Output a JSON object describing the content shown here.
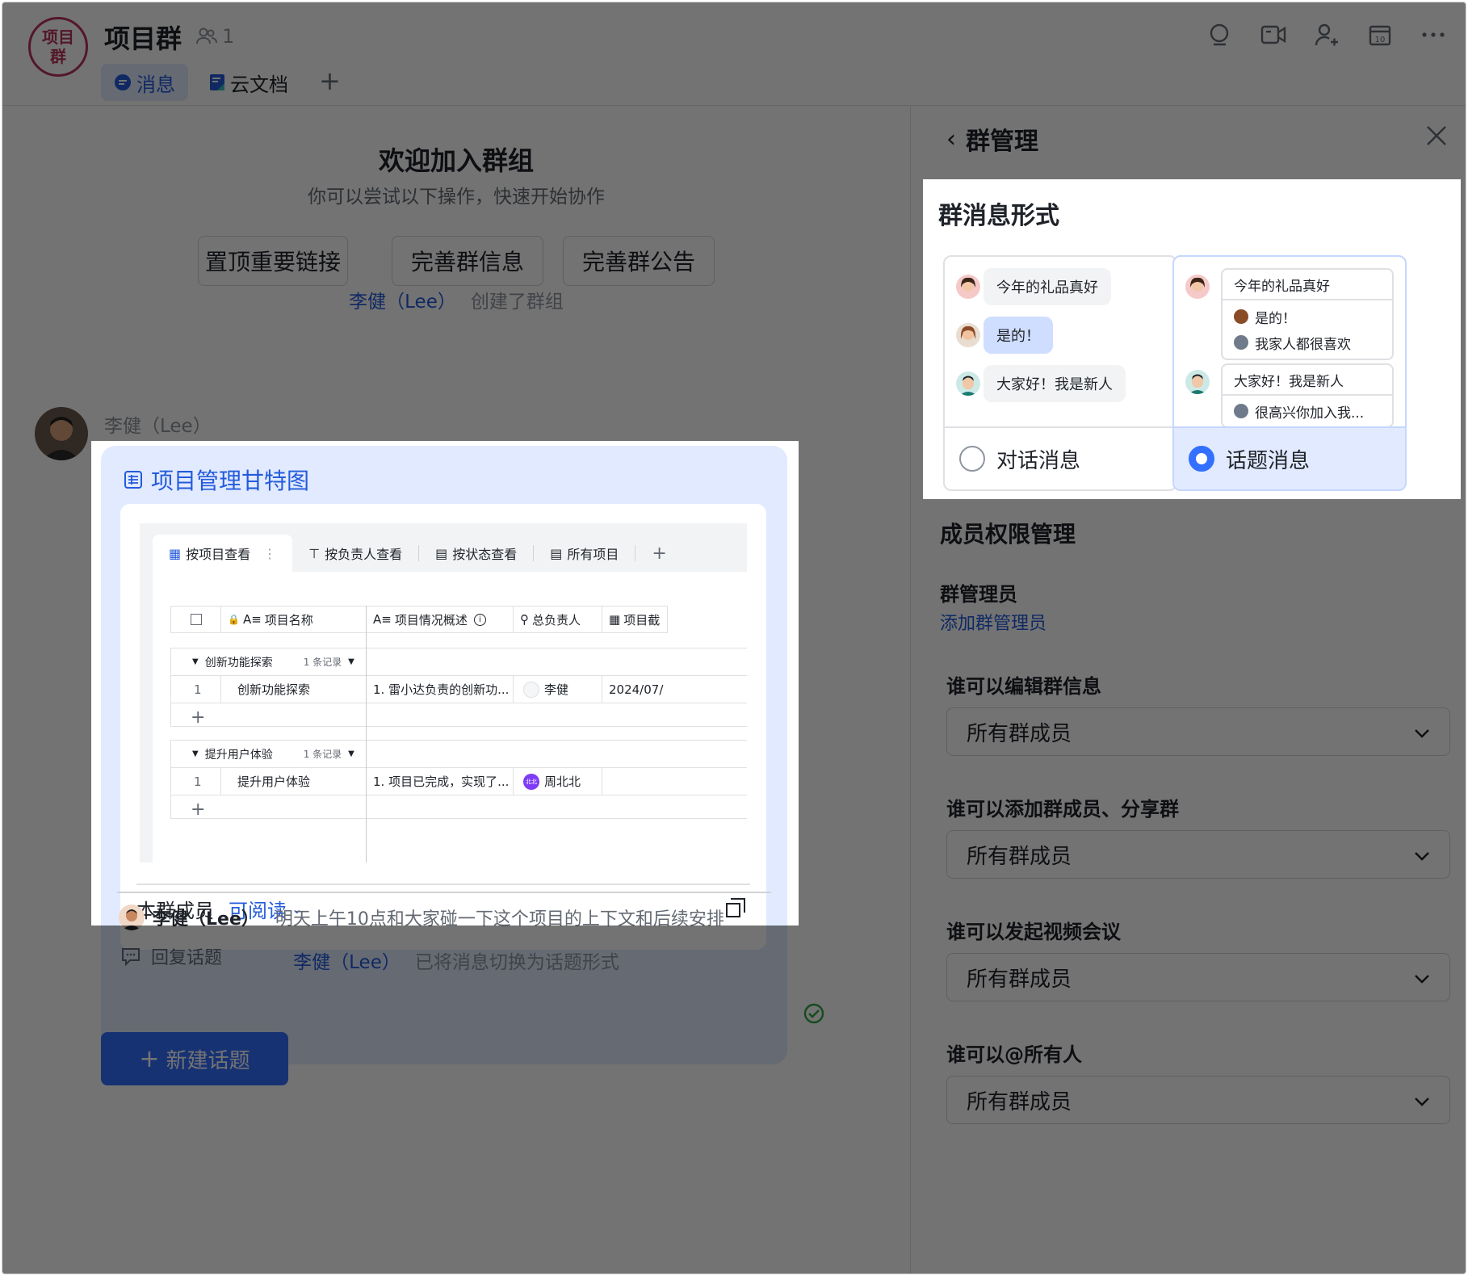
{
  "header": {
    "logo_text": "项目群",
    "title": "项目群",
    "member_count": "1",
    "tabs": [
      {
        "label": "消息",
        "icon": "chat-bubble-icon"
      },
      {
        "label": "云文档",
        "icon": "doc-icon"
      }
    ],
    "add_tab": "+",
    "actions": [
      "search-icon",
      "video-call-icon",
      "add-member-icon",
      "calendar-icon",
      "more-icon"
    ],
    "calendar_day": "10"
  },
  "chat": {
    "welcome_title": "欢迎加入群组",
    "welcome_sub": "你可以尝试以下操作，快速开始协作",
    "quick_actions": [
      "置顶重要链接",
      "完善群信息",
      "完善群公告"
    ],
    "sys_created": {
      "name": "李健（Lee）",
      "text": "创建了群组"
    },
    "sender": "李健（Lee）",
    "card": {
      "title": "项目管理甘特图",
      "view_tabs": [
        "按项目查看",
        "按负责人查看",
        "按状态查看",
        "所有项目"
      ],
      "columns": [
        "项目名称",
        "项目情况概述",
        "总负责人",
        "项目截"
      ],
      "groups": [
        {
          "name": "创新功能探索",
          "count": "1 条记录",
          "row": {
            "idx": "1",
            "name": "创新功能探索",
            "desc": "1. 雷小达负责的创新功...",
            "owner": "李健",
            "date": "2024/07/"
          }
        },
        {
          "name": "提升用户体验",
          "count": "1 条记录",
          "row": {
            "idx": "1",
            "name": "提升用户体验",
            "desc": "1. 项目已完成，实现了...",
            "owner": "周北北",
            "owner_badge": "北北",
            "date": ""
          }
        }
      ],
      "add_row": "+",
      "perm_scope": "本群成员",
      "perm_level": "可阅读",
      "reply": {
        "name": "李健（Lee）",
        "text": "明天上午10点和大家碰一下这个项目的上下文和后续安排"
      },
      "reply_btn": "回复话题"
    },
    "sys_switched": {
      "name": "李健（Lee）",
      "text": "已将消息切换为话题形式"
    },
    "new_topic": "新建话题"
  },
  "panel": {
    "title": "群管理",
    "format_title": "群消息形式",
    "chat_option": {
      "label": "对话消息",
      "selected": false,
      "bubbles": [
        "今年的礼品真好",
        "是的！",
        "大家好！我是新人"
      ]
    },
    "topic_option": {
      "label": "话题消息",
      "selected": true,
      "topics": [
        {
          "head": "今年的礼品真好",
          "replies": [
            "是的！",
            "我家人都很喜欢"
          ]
        },
        {
          "head": "大家好！我是新人",
          "replies": [
            "很高兴你加入我..."
          ]
        }
      ]
    },
    "perm_title": "成员权限管理",
    "admin_title": "群管理员",
    "add_admin": "添加群管理员",
    "settings": [
      {
        "q": "谁可以编辑群信息",
        "value": "所有群成员"
      },
      {
        "q": "谁可以添加群成员、分享群",
        "value": "所有群成员"
      },
      {
        "q": "谁可以发起视频会议",
        "value": "所有群成员"
      },
      {
        "q": "谁可以@所有人",
        "value": "所有群成员"
      }
    ]
  },
  "colors": {
    "accent": "#3370ff",
    "link": "#245bdb",
    "brand_logo": "#b8345c"
  }
}
